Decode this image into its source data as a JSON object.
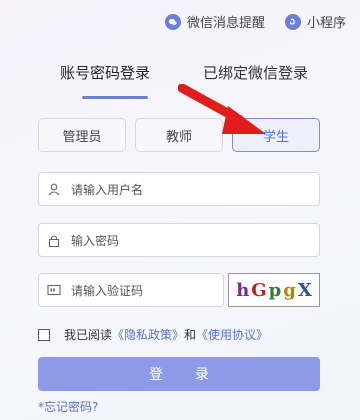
{
  "top_links": {
    "wechat_notify": "微信消息提醒",
    "mini_program": "小程序"
  },
  "tabs": {
    "account_login": "账号密码登录",
    "wechat_login": "已绑定微信登录",
    "active": "account_login"
  },
  "roles": [
    "管理员",
    "教师",
    "学生"
  ],
  "selected_role": "学生",
  "form": {
    "username_placeholder": "请输入用户名",
    "password_placeholder": "输入密码",
    "captcha_placeholder": "请输入验证码",
    "captcha_chars": [
      "h",
      "G",
      "p",
      "g",
      "X"
    ]
  },
  "agreement": {
    "prefix": "我已阅读",
    "privacy": "《隐私政策》",
    "conj": "和",
    "terms": "《使用协议》"
  },
  "login_button": "登录",
  "forgot_password": "*忘记密码?",
  "colors": {
    "accent": "#6b7fd7",
    "button": "#8d9ae6",
    "arrow": "#e21b1b",
    "link": "#5a6fd1"
  },
  "icons": [
    "wechat-icon",
    "mini-program-icon",
    "user-icon",
    "lock-icon",
    "captcha-icon",
    "red-arrow"
  ]
}
